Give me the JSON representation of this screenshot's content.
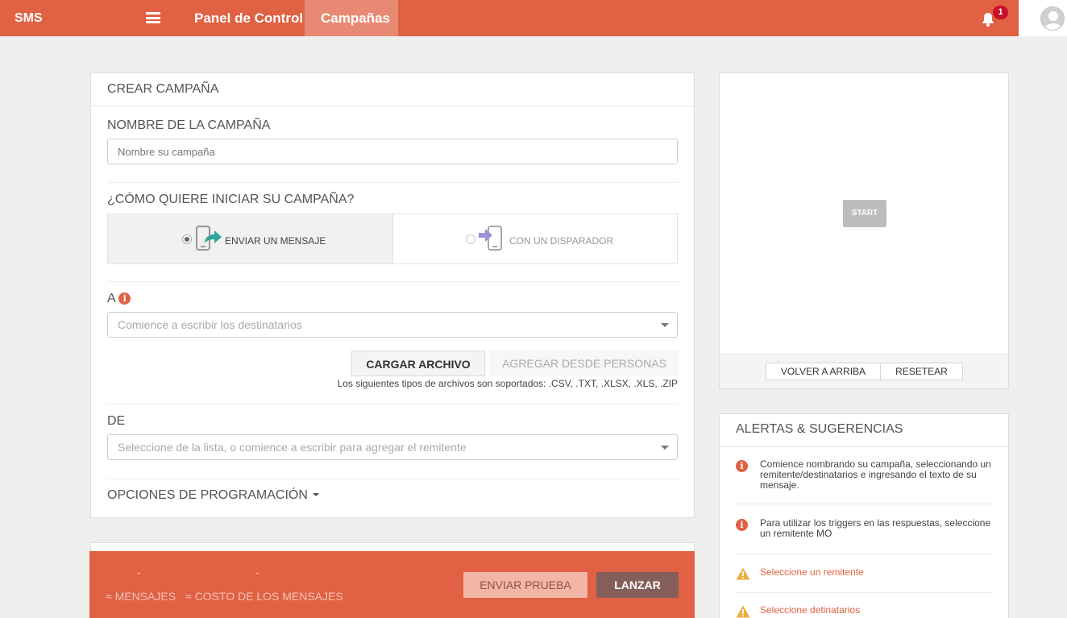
{
  "topbar": {
    "brand": "SMS",
    "nav": [
      {
        "label": "Panel de Control",
        "active": false
      },
      {
        "label": "Campañas",
        "active": true
      }
    ],
    "notifications_count": "1",
    "accent_color": "#e06143"
  },
  "create": {
    "title": "CREAR CAMPAÑA",
    "name_label": "NOMBRE DE LA CAMPAÑA",
    "name_placeholder": "Nombre su campaña",
    "start_label": "¿CÓMO QUIERE INICIAR SU CAMPAÑA?",
    "options": [
      {
        "label": "ENVIAR UN MENSAJE",
        "selected": true,
        "icon": "phone-send-icon"
      },
      {
        "label": "CON UN DISPARADOR",
        "selected": false,
        "icon": "phone-trigger-icon"
      }
    ],
    "to_label": "A",
    "to_placeholder": "Comience a escribir los destinatarios",
    "upload_button": "CARGAR ARCHIVO",
    "people_button": "AGREGAR DESDE PERSONAS",
    "filetypes_note": "Los siguientes tipos de archivos son soportados: .CSV, .TXT, .XLSX, .XLS, .ZIP",
    "from_label": "DE",
    "from_placeholder": "Seleccione de la lista, o comience a escribir para agregar el remitente",
    "schedule_label": "OPCIONES DE PROGRAMACIÓN"
  },
  "summary": {
    "messages_value": "-",
    "messages_label": "≈ MENSAJES",
    "cost_value": "-",
    "cost_label": "≈ COSTO DE LOS MENSAJES",
    "test_button": "ENVIAR PRUEBA",
    "launch_button": "LANZAR"
  },
  "preview": {
    "start_button": "START",
    "top_button": "VOLVER A ARRIBA",
    "reset_button": "RESETEAR"
  },
  "alerts": {
    "title": "ALERTAS & SUGERENCIAS",
    "items": [
      {
        "type": "info",
        "text": "Comience nombrando su campaña, seleccionando un remitente/destinatarios e ingresando el texto de su mensaje."
      },
      {
        "type": "info",
        "text": "Para utilizar los triggers en las respuestas, seleccione un remitente MO"
      },
      {
        "type": "warning",
        "text": "Seleccione un remitente"
      },
      {
        "type": "warning",
        "text": "Seleccione detinatarios"
      }
    ]
  }
}
